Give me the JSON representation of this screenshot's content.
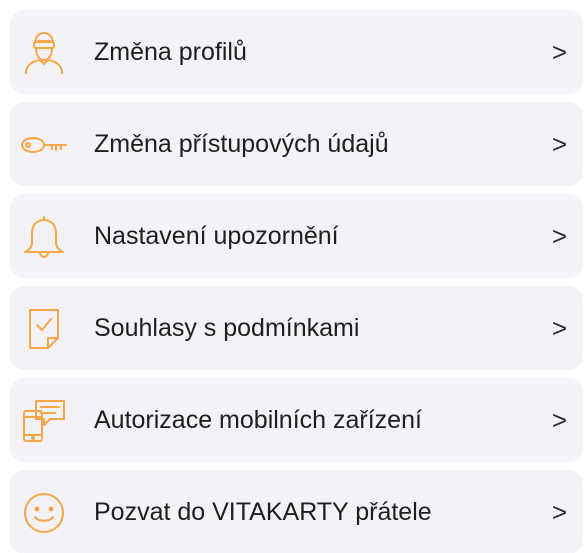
{
  "accent_color": "#f5a646",
  "menu": {
    "items": [
      {
        "label": "Změna profilů",
        "icon": "user-profile-icon",
        "chevron": ">"
      },
      {
        "label": "Změna přístupových údajů",
        "icon": "key-icon",
        "chevron": ">"
      },
      {
        "label": "Nastavení upozornění",
        "icon": "bell-icon",
        "chevron": ">"
      },
      {
        "label": "Souhlasy s podmínkami",
        "icon": "document-check-icon",
        "chevron": ">"
      },
      {
        "label": "Autorizace mobilních zařízení",
        "icon": "mobile-device-icon",
        "chevron": ">"
      },
      {
        "label": "Pozvat do VITAKARTY přátele",
        "icon": "smiley-icon",
        "chevron": ">"
      }
    ]
  }
}
